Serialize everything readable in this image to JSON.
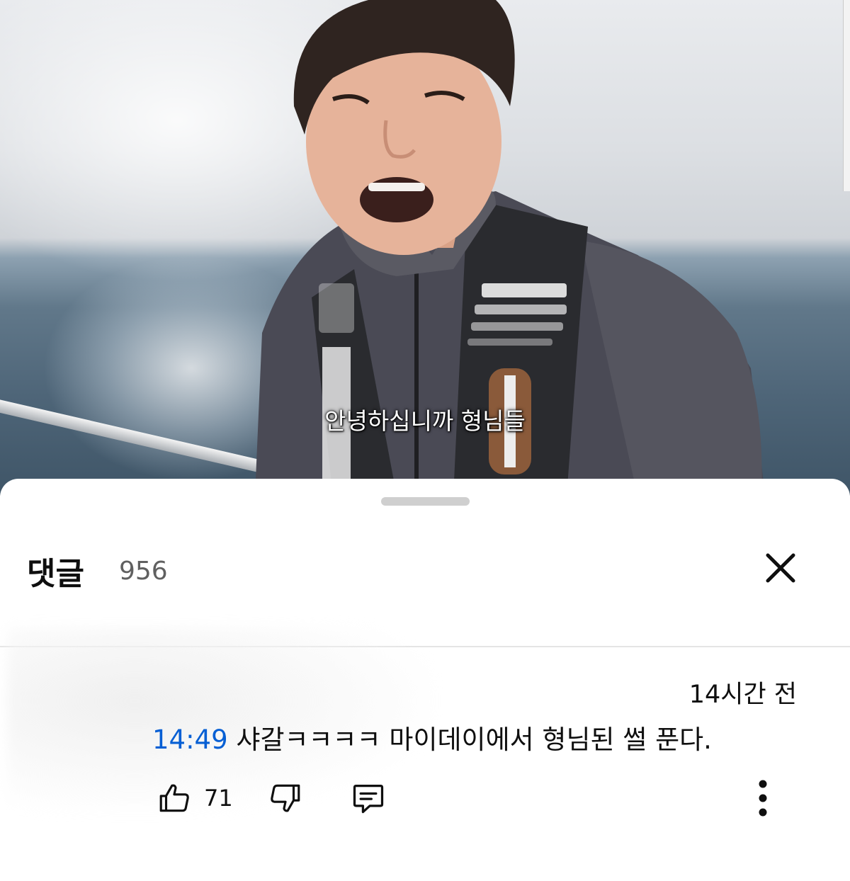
{
  "video": {
    "subtitle": "안녕하십니까 형님들"
  },
  "comments_sheet": {
    "title": "댓글",
    "count": "956",
    "close_icon": "close-icon"
  },
  "comment": {
    "time_ago": "14시간 전",
    "timestamp_link": "14:49",
    "text": " 샤갈ㅋㅋㅋㅋ 마이데이에서 형님된 썰 푼다.",
    "likes": "71",
    "icons": [
      "thumbs-up-icon",
      "thumbs-down-icon",
      "reply-icon",
      "more-vert-icon"
    ]
  }
}
